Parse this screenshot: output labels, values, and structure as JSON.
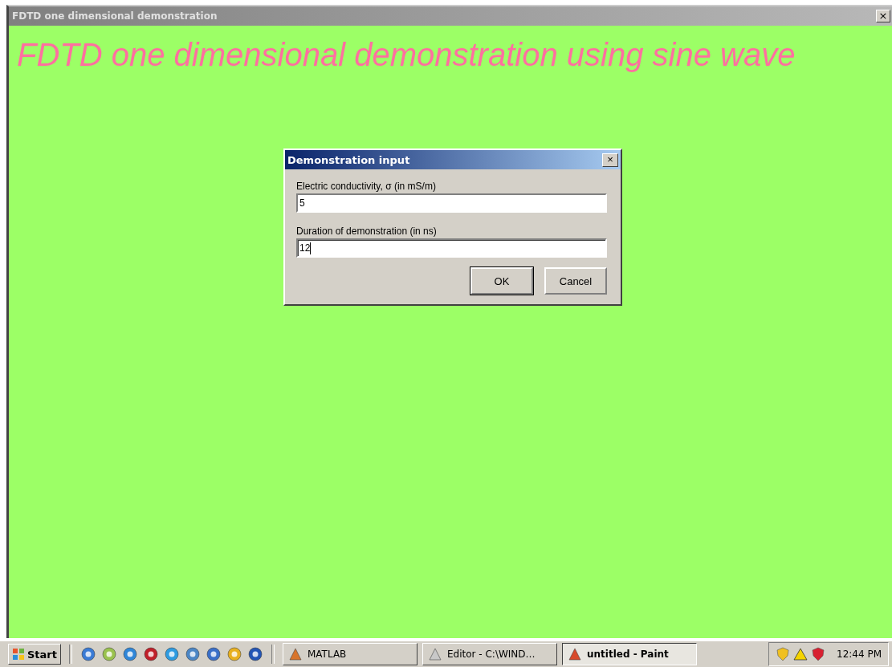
{
  "window": {
    "title": "FDTD one dimensional demonstration",
    "close": "×"
  },
  "heading": "FDTD one dimensional demonstration using sine wave",
  "dialog": {
    "title": "Demonstration input",
    "close": "×",
    "fields": [
      {
        "label": "Electric conductivity, σ (in mS/m)",
        "value": "5",
        "focused": false
      },
      {
        "label": "Duration of demonstration (in ns)",
        "value": "12",
        "focused": true
      }
    ],
    "buttons": [
      {
        "label": "OK",
        "default": true
      },
      {
        "label": "Cancel",
        "default": false
      }
    ]
  },
  "taskbar": {
    "start": "Start",
    "tasks": [
      {
        "label": "MATLAB",
        "selected": false
      },
      {
        "label": "Editor - C:\\WIND…",
        "selected": false
      },
      {
        "label": "untitled - Paint",
        "selected": true
      }
    ],
    "clock": "12:44 PM"
  }
}
